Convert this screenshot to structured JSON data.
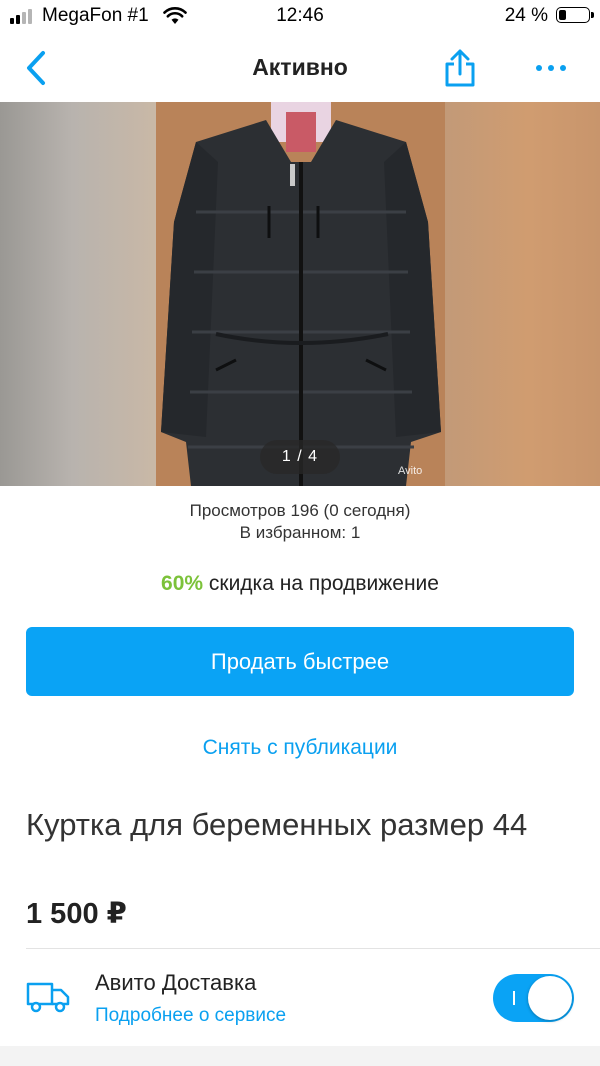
{
  "status_bar": {
    "carrier": "MegaFon #1",
    "time": "12:46",
    "battery": "24 %",
    "battery_level": 0.24
  },
  "nav": {
    "title": "Активно",
    "icons": [
      "back-chevron-icon",
      "share-icon",
      "more-dots-icon"
    ],
    "accent_color": "#0aa0f0"
  },
  "gallery": {
    "counter": "1 / 4",
    "watermark": "Avito"
  },
  "stats": {
    "views": "Просмотров 196 (0 сегодня)",
    "favorites": "В избранном: 1"
  },
  "promo": {
    "percent": "60%",
    "text": " скидка на продвижение",
    "percent_color": "#7cc23a"
  },
  "actions": {
    "sell_faster": "Продать быстрее",
    "unpublish": "Снять с публикации"
  },
  "item": {
    "title": "Куртка для беременных размер 44",
    "price": "1 500 ₽"
  },
  "delivery": {
    "title": "Авито Доставка",
    "link": "Подробнее о сервисе",
    "enabled": true,
    "icon": "truck-icon"
  }
}
